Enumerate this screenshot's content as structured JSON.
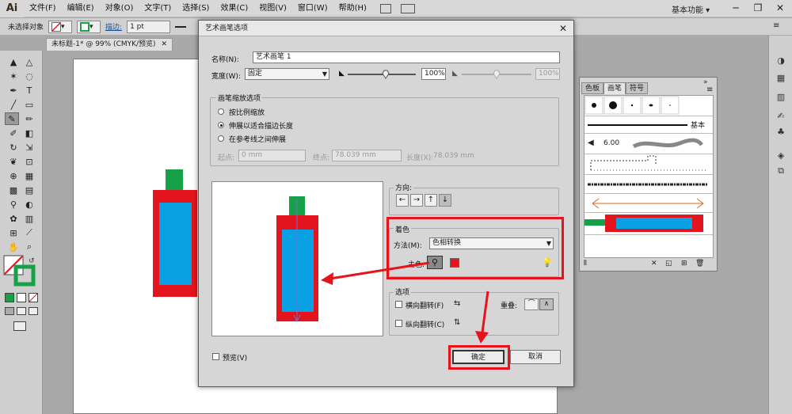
{
  "app": {
    "logo": "Ai",
    "workspace": "基本功能 ▾"
  },
  "menu": [
    "文件(F)",
    "编辑(E)",
    "对象(O)",
    "文字(T)",
    "选择(S)",
    "效果(C)",
    "视图(V)",
    "窗口(W)",
    "帮助(H)"
  ],
  "window_buttons": [
    "─",
    "❐",
    "✕"
  ],
  "controlbar": {
    "selection": "未选择对象",
    "stroke_label": "描边:",
    "stroke_value": "1 pt"
  },
  "doc_tab": {
    "title": "未标题-1* @ 99% (CMYK/预览)",
    "close": "✕"
  },
  "brush_panel": {
    "tabs": [
      "色板",
      "画笔",
      "符号"
    ],
    "basic_label": "基本",
    "size_label": "6.00"
  },
  "dialog": {
    "title": "艺术画笔选项",
    "name_label": "名称(N):",
    "name_value": "艺术画笔 1",
    "width_label": "宽度(W):",
    "width_value": "固定",
    "width_pct": "100%",
    "width_pct2": "100%",
    "scale_group_label": "画笔缩放选项",
    "scale_opt1": "按比例缩放",
    "scale_opt2": "伸展以适合描边长度",
    "scale_opt3": "在参考线之间伸展",
    "start_label": "起点:",
    "start_value": "0 mm",
    "end_label": "终点:",
    "end_value": "78.039 mm",
    "length_label": "长度(X):",
    "length_value": "78.039 mm",
    "direction_label": "方向:",
    "directions": [
      "←",
      "→",
      "↑",
      "↓"
    ],
    "color_group_label": "着色",
    "method_label": "方法(M):",
    "method_value": "色相转换",
    "key_color_label": "主色:",
    "options_group_label": "选项",
    "flip_h": "横向翻转(F)",
    "flip_v": "纵向翻转(C)",
    "overlap_label": "重叠:",
    "preview_label": "预览(V)",
    "ok": "确定",
    "cancel": "取消"
  },
  "colors": {
    "red": "#e3141d",
    "blue": "#0aa0e4",
    "green": "#16a047",
    "highlight": "#e8121b"
  }
}
